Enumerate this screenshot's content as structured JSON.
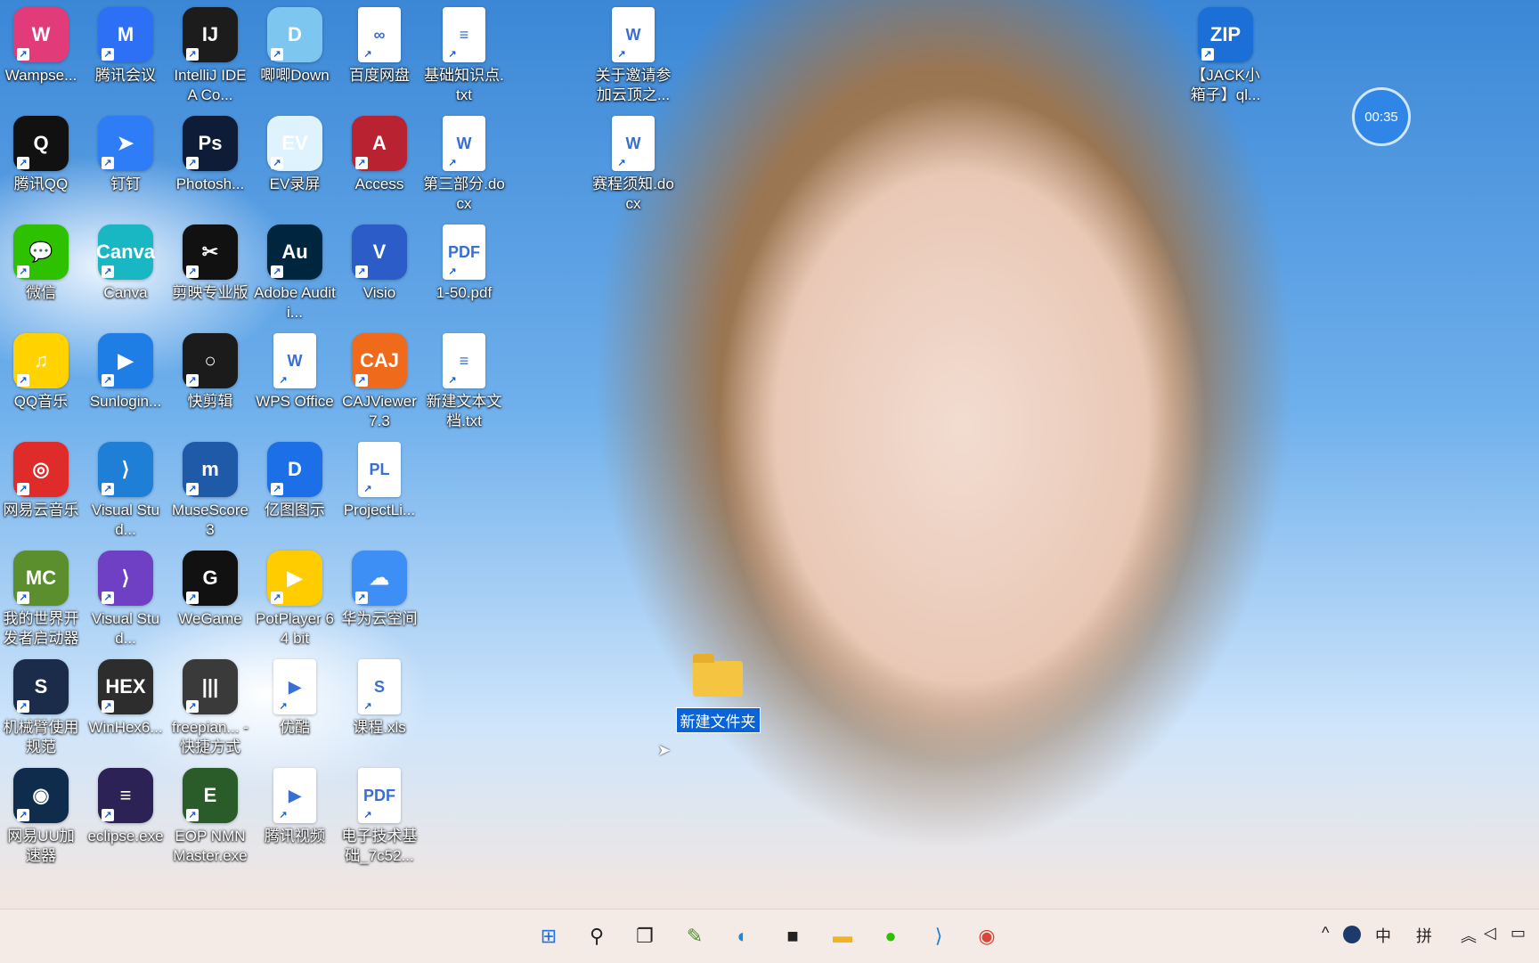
{
  "desktop": {
    "icons": [
      {
        "label": "Wampse...",
        "color": "#e23b7a",
        "glyph": "W"
      },
      {
        "label": "腾讯会议",
        "color": "#2d6ff5",
        "glyph": "M"
      },
      {
        "label": "IntelliJ IDEA Co...",
        "color": "#1c1c1c",
        "glyph": "IJ"
      },
      {
        "label": "唧唧Down",
        "color": "#7cc6f0",
        "glyph": "D"
      },
      {
        "label": "百度网盘",
        "color": "#ffffff",
        "glyph": "∞"
      },
      {
        "label": "基础知识点.txt",
        "color": "#ffffff",
        "glyph": "≡"
      },
      {
        "label": "腾讯QQ",
        "color": "#111111",
        "glyph": "Q"
      },
      {
        "label": "钉钉",
        "color": "#2e7cf6",
        "glyph": "➤"
      },
      {
        "label": "Photosh...",
        "color": "#0e1c38",
        "glyph": "Ps"
      },
      {
        "label": "EV录屏",
        "color": "#dff3ff",
        "glyph": "EV"
      },
      {
        "label": "Access",
        "color": "#b82231",
        "glyph": "A"
      },
      {
        "label": "第三部分.docx",
        "color": "#ffffff",
        "glyph": "W"
      },
      {
        "label": "微信",
        "color": "#2dc100",
        "glyph": "💬"
      },
      {
        "label": "Canva",
        "color": "#19b6c3",
        "glyph": "Canva"
      },
      {
        "label": "剪映专业版",
        "color": "#111111",
        "glyph": "✂"
      },
      {
        "label": "Adobe Auditi...",
        "color": "#00263f",
        "glyph": "Au"
      },
      {
        "label": "Visio",
        "color": "#2b5cc7",
        "glyph": "V"
      },
      {
        "label": "1-50.pdf",
        "color": "#ffffff",
        "glyph": "PDF"
      },
      {
        "label": "QQ音乐",
        "color": "#ffd200",
        "glyph": "♫"
      },
      {
        "label": "Sunlogin...",
        "color": "#1f7ee6",
        "glyph": "▶"
      },
      {
        "label": "快剪辑",
        "color": "#1b1b1b",
        "glyph": "○"
      },
      {
        "label": "WPS Office",
        "color": "#ffffff",
        "glyph": "W"
      },
      {
        "label": "CAJViewer 7.3",
        "color": "#f06a1b",
        "glyph": "CAJ"
      },
      {
        "label": "新建文本文档.txt",
        "color": "#ffffff",
        "glyph": "≡"
      },
      {
        "label": "网易云音乐",
        "color": "#e02b2b",
        "glyph": "◎"
      },
      {
        "label": "Visual Stud...",
        "color": "#1f7fd6",
        "glyph": "⟩"
      },
      {
        "label": "MuseScore 3",
        "color": "#1e5aa8",
        "glyph": "m"
      },
      {
        "label": "亿图图示",
        "color": "#1c6fe6",
        "glyph": "D"
      },
      {
        "label": "ProjectLi...",
        "color": "#ffffff",
        "glyph": "PL"
      },
      {
        "label": "我的世界开发者启动器",
        "color": "#5b8f2e",
        "glyph": "MC"
      },
      {
        "label": "Visual Stud...",
        "color": "#6f3fc4",
        "glyph": "⟩"
      },
      {
        "label": "WeGame",
        "color": "#111111",
        "glyph": "G"
      },
      {
        "label": "PotPlayer 64 bit",
        "color": "#ffcc00",
        "glyph": "▶"
      },
      {
        "label": "华为云空间",
        "color": "#3d8ef5",
        "glyph": "☁"
      },
      {
        "label": "机械臂使用规范",
        "color": "#1b2b4a",
        "glyph": "S"
      },
      {
        "label": "WinHex6...",
        "color": "#2d2d2d",
        "glyph": "HEX"
      },
      {
        "label": "freepian... - 快捷方式",
        "color": "#3a3a3a",
        "glyph": "|||"
      },
      {
        "label": "优酷",
        "color": "#ffffff",
        "glyph": "▶"
      },
      {
        "label": "课程.xls",
        "color": "#ffffff",
        "glyph": "S"
      },
      {
        "label": "网易UU加速器",
        "color": "#0f2c4d",
        "glyph": "◉"
      },
      {
        "label": "eclipse.exe",
        "color": "#2c2255",
        "glyph": "≡"
      },
      {
        "label": "EOP NMN Master.exe",
        "color": "#2a5c2a",
        "glyph": "E"
      },
      {
        "label": "腾讯视频",
        "color": "#ffffff",
        "glyph": "▶"
      },
      {
        "label": "电子技术基础_7c52...",
        "color": "#ffffff",
        "glyph": "PDF"
      },
      {
        "label": "关于邀请参加云顶之...",
        "color": "#ffffff",
        "glyph": "W"
      },
      {
        "label": "赛程须知.docx",
        "color": "#ffffff",
        "glyph": "W"
      },
      {
        "label": "【JACK小箱子】ql...",
        "color": "#1c6fd6",
        "glyph": "ZIP"
      }
    ],
    "new_folder_label": "新建文件夹",
    "timer": "00:35"
  },
  "taskbar": {
    "apps": [
      {
        "name": "start-icon",
        "glyph": "⊞",
        "color": "#1a73e8"
      },
      {
        "name": "search-icon",
        "glyph": "⚲",
        "color": "#222"
      },
      {
        "name": "task-view-icon",
        "glyph": "❐",
        "color": "#222"
      },
      {
        "name": "notes-app-icon",
        "glyph": "✎",
        "color": "#4a8f2a"
      },
      {
        "name": "edge-icon",
        "glyph": "◐",
        "color": "#1a8ad8"
      },
      {
        "name": "sticky-notes-icon",
        "glyph": "■",
        "color": "#222"
      },
      {
        "name": "file-explorer-icon",
        "glyph": "▬",
        "color": "#f1b324"
      },
      {
        "name": "wechat-icon",
        "glyph": "●",
        "color": "#2dc100"
      },
      {
        "name": "vscode-icon",
        "glyph": "⟩",
        "color": "#1f7fd6"
      },
      {
        "name": "chrome-icon",
        "glyph": "◉",
        "color": "#db4437"
      }
    ],
    "tray": {
      "chevron": "^",
      "ime_lang": "中",
      "ime_mode": "拼"
    }
  }
}
